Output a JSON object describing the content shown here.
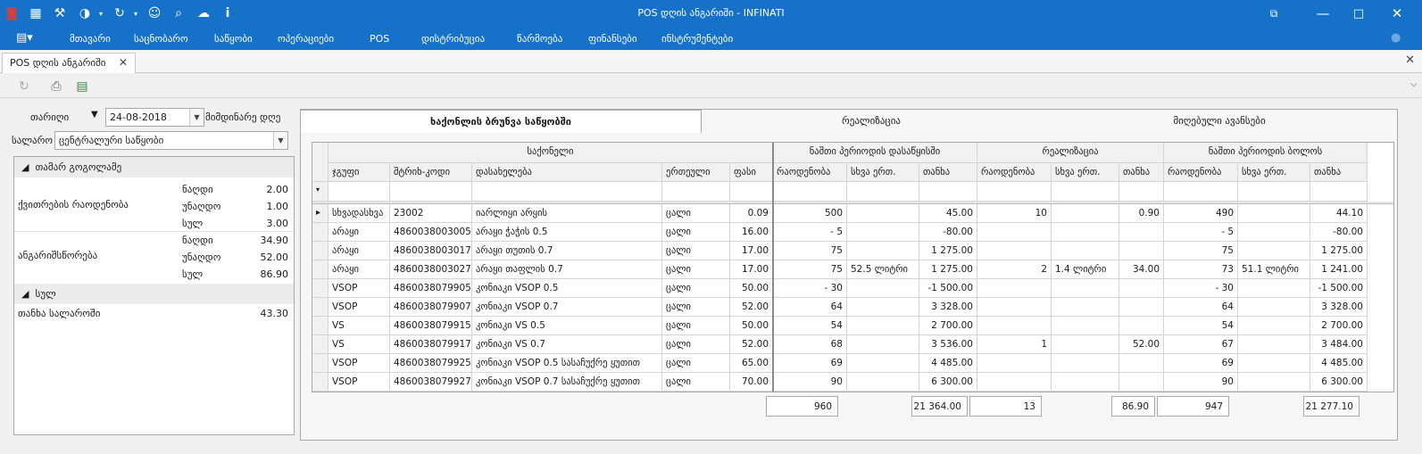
{
  "window": {
    "title": "POS დღის ანგარიში - INFINATI",
    "quick_icons": [
      "brand-icon",
      "calendar-icon",
      "tools-icon",
      "palette-icon",
      "refresh-icon",
      "user-icon",
      "search-icon",
      "cloud-icon",
      "info-icon"
    ]
  },
  "menu": {
    "items": [
      "მთავარი",
      "საცნობარო",
      "საწყობი",
      "ოპერაციები",
      "POS",
      "დისტრიბუცია",
      "წარმოება",
      "ფინანსები",
      "ინსტრუმენტები"
    ]
  },
  "doc_tab": {
    "label": "POS დღის ანგარიში"
  },
  "filters": {
    "date_label": "თარიღი",
    "date_value": "24-08-2018",
    "current_day_label": "მიმდინარე დღე",
    "cashbox_label": "სალარო",
    "cashbox_value": "ცენტრალური საწყობი"
  },
  "summary": {
    "group1": "თამარ გოგოლამე",
    "receipts_count_label": "ქვითრების რაოდენობა",
    "receipts": [
      {
        "label": "ნაღდი",
        "value": "2.00"
      },
      {
        "label": "უნაღდო",
        "value": "1.00"
      },
      {
        "label": "სულ",
        "value": "3.00"
      }
    ],
    "settlement_label": "ანგარიშსწორება",
    "settlement": [
      {
        "label": "ნაღდი",
        "value": "34.90"
      },
      {
        "label": "უნაღდო",
        "value": "52.00"
      },
      {
        "label": "სულ",
        "value": "86.90"
      }
    ],
    "group2": "სულ",
    "cash_in_box_label": "თანხა სალაროში",
    "cash_in_box_value": "43.30"
  },
  "panel_tabs": [
    "ხაქონლის ბრუნვა საწყობში",
    "რეალიზაცია",
    "მიღებული ავანსები"
  ],
  "grid": {
    "bands": {
      "goods": "საქონელი",
      "start": "ნაშთი პერიოდის დასაწყისში",
      "sales": "რეალიზაცია",
      "end": "ნაშთი პერიოდის ბოლოს"
    },
    "columns": [
      "ჯგუფი",
      "შტრიხ-კოდი",
      "დასახელება",
      "ერთეული",
      "ფასი",
      "რაოდენობა",
      "სხვა ერთ.",
      "თანხა",
      "რაოდენობა",
      "სხვა ერთ.",
      "თანხა",
      "რაოდენობა",
      "სხვა ერთ.",
      "თანხა"
    ],
    "rows": [
      [
        "სხვადასხვა",
        "23002",
        "იარლიყი არყის",
        "ცალი",
        "0.09",
        "500",
        "",
        "45.00",
        "10",
        "",
        "0.90",
        "490",
        "",
        "44.10"
      ],
      [
        "არაყი",
        "4860038003005",
        "არაყი ჭაჭის 0.5",
        "ცალი",
        "16.00",
        "- 5",
        "",
        "-80.00",
        "",
        "",
        "",
        "- 5",
        "",
        "-80.00"
      ],
      [
        "არაყი",
        "4860038003017",
        "არაყი თუთის 0.7",
        "ცალი",
        "17.00",
        "75",
        "",
        "1 275.00",
        "",
        "",
        "",
        "75",
        "",
        "1 275.00"
      ],
      [
        "არაყი",
        "4860038003027",
        "არაყი თაფლის 0.7",
        "ცალი",
        "17.00",
        "75",
        "52.5   ლიტრი",
        "1 275.00",
        "2",
        "1.4   ლიტრი",
        "34.00",
        "73",
        "51.1   ლიტრი",
        "1 241.00"
      ],
      [
        "VSOP",
        "4860038079905",
        "კონიაკი VSOP 0.5",
        "ცალი",
        "50.00",
        "- 30",
        "",
        "-1 500.00",
        "",
        "",
        "",
        "- 30",
        "",
        "-1 500.00"
      ],
      [
        "VSOP",
        "4860038079907",
        "კონიაკი VSOP 0.7",
        "ცალი",
        "52.00",
        "64",
        "",
        "3 328.00",
        "",
        "",
        "",
        "64",
        "",
        "3 328.00"
      ],
      [
        "VS",
        "4860038079915",
        "კონიაკი VS 0.5",
        "ცალი",
        "50.00",
        "54",
        "",
        "2 700.00",
        "",
        "",
        "",
        "54",
        "",
        "2 700.00"
      ],
      [
        "VS",
        "4860038079917",
        "კონიაკი VS 0.7",
        "ცალი",
        "52.00",
        "68",
        "",
        "3 536.00",
        "1",
        "",
        "52.00",
        "67",
        "",
        "3 484.00"
      ],
      [
        "VSOP",
        "4860038079925",
        "კონიაკი VSOP 0.5 სასაჩუქრე ყუთით",
        "ცალი",
        "65.00",
        "69",
        "",
        "4 485.00",
        "",
        "",
        "",
        "69",
        "",
        "4 485.00"
      ],
      [
        "VSOP",
        "4860038079927",
        "კონიაკი VSOP 0.7 სასაჩუქრე ყუთით",
        "ცალი",
        "70.00",
        "90",
        "",
        "6 300.00",
        "",
        "",
        "",
        "90",
        "",
        "6 300.00"
      ]
    ],
    "totals": {
      "start_qty": "960",
      "start_sum": "21 364.00",
      "sales_qty": "13",
      "sales_sum": "86.90",
      "end_qty": "947",
      "end_sum": "21 277.10"
    }
  }
}
